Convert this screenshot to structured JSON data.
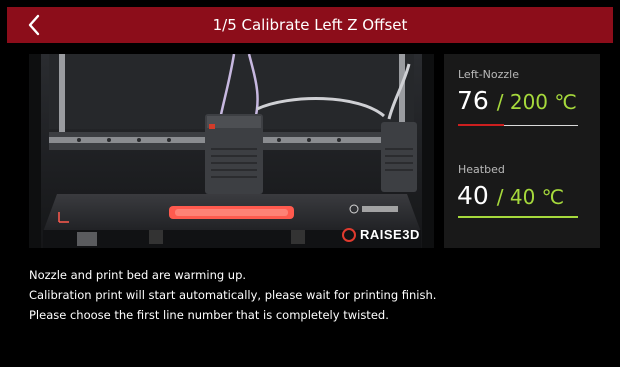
{
  "header": {
    "title": "1/5 Calibrate Left Z Offset",
    "back_icon": "chevron-left-icon"
  },
  "photo": {
    "brand_label": "RAISE3D",
    "brand_icon": "raise3d-logo-icon"
  },
  "temperatures": {
    "nozzle": {
      "label": "Left-Nozzle",
      "current": "76",
      "target": "/ 200 ℃",
      "progress": 0.38,
      "color": "#cc1f1f"
    },
    "heatbed": {
      "label": "Heatbed",
      "current": "40",
      "target": "/ 40 ℃",
      "progress": 1.0,
      "color": "#a6d93c"
    }
  },
  "message": {
    "line1": "Nozzle and print bed are warming up.",
    "line2": "Calibration print will start automatically, please wait for printing finish.",
    "line3": "Please choose the first line number that is completely twisted."
  },
  "colors": {
    "header_bg": "#8c0d1a",
    "accent_green": "#a6d93c",
    "accent_red": "#cc1f1f"
  }
}
